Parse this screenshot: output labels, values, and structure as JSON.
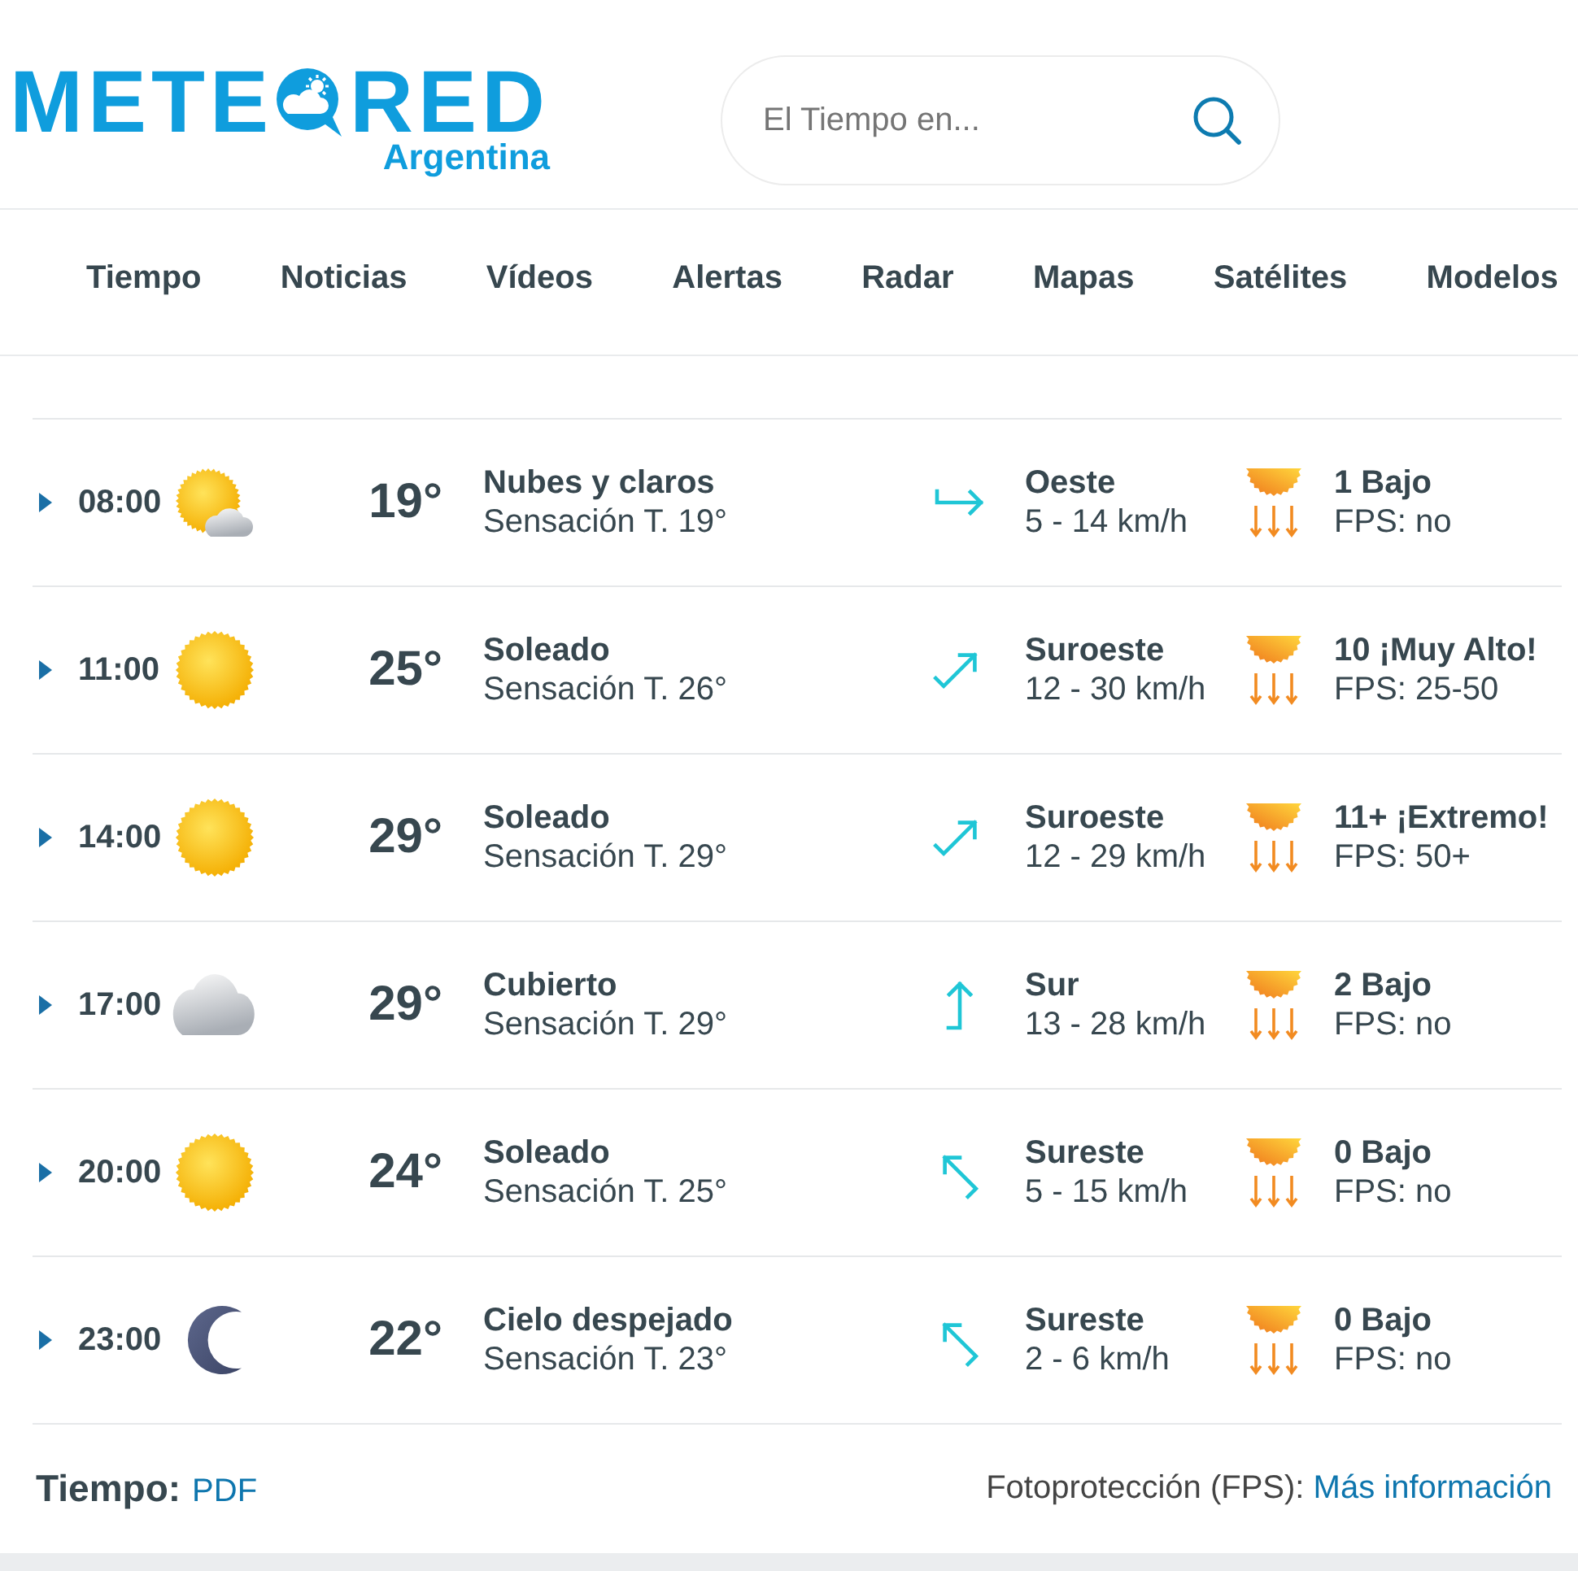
{
  "header": {
    "logo": {
      "before_icon": "METE",
      "after_icon": "RED",
      "region": "Argentina"
    },
    "search": {
      "placeholder": "El Tiempo en..."
    }
  },
  "nav": {
    "items": [
      {
        "label": "Tiempo"
      },
      {
        "label": "Noticias"
      },
      {
        "label": "Vídeos"
      },
      {
        "label": "Alertas"
      },
      {
        "label": "Radar"
      },
      {
        "label": "Mapas"
      },
      {
        "label": "Satélites"
      },
      {
        "label": "Modelos"
      }
    ]
  },
  "forecast": {
    "rows": [
      {
        "time": "08:00",
        "expanded": false,
        "sky": {
          "kind": "sun-cloud"
        },
        "temperature": "19°",
        "condition": "Nubes y claros",
        "feels_like": "Sensación T. 19°",
        "wind": {
          "kind": "east",
          "direction": "Oeste",
          "speed": "5 - 14 km/h"
        },
        "uv": "1 Bajo",
        "fps": "FPS: no"
      },
      {
        "time": "11:00",
        "expanded": false,
        "sky": {
          "kind": "sun"
        },
        "temperature": "25°",
        "condition": "Soleado",
        "feels_like": "Sensación T. 26°",
        "wind": {
          "kind": "northeast",
          "direction": "Suroeste",
          "speed": "12 - 30 km/h"
        },
        "uv": "10 ¡Muy Alto!",
        "fps": "FPS: 25-50"
      },
      {
        "time": "14:00",
        "expanded": false,
        "sky": {
          "kind": "sun"
        },
        "temperature": "29°",
        "condition": "Soleado",
        "feels_like": "Sensación T. 29°",
        "wind": {
          "kind": "northeast",
          "direction": "Suroeste",
          "speed": "12 - 29 km/h"
        },
        "uv": "11+ ¡Extremo!",
        "fps": "FPS: 50+"
      },
      {
        "time": "17:00",
        "expanded": false,
        "sky": {
          "kind": "cloud"
        },
        "temperature": "29°",
        "condition": "Cubierto",
        "feels_like": "Sensación T. 29°",
        "wind": {
          "kind": "north",
          "direction": "Sur",
          "speed": "13 - 28 km/h"
        },
        "uv": "2 Bajo",
        "fps": "FPS: no"
      },
      {
        "time": "20:00",
        "expanded": false,
        "sky": {
          "kind": "sun"
        },
        "temperature": "24°",
        "condition": "Soleado",
        "feels_like": "Sensación T. 25°",
        "wind": {
          "kind": "northwest",
          "direction": "Sureste",
          "speed": "5 - 15 km/h"
        },
        "uv": "0 Bajo",
        "fps": "FPS: no"
      },
      {
        "time": "23:00",
        "expanded": false,
        "sky": {
          "kind": "moon"
        },
        "temperature": "22°",
        "condition": "Cielo despejado",
        "feels_like": "Sensación T. 23°",
        "wind": {
          "kind": "northwest",
          "direction": "Sureste",
          "speed": "2 - 6 km/h"
        },
        "uv": "0 Bajo",
        "fps": "FPS: no"
      }
    ]
  },
  "footer": {
    "label": "Tiempo:",
    "link": "PDF",
    "note": "Fotoprotección (FPS):",
    "note_link": "Más información"
  }
}
